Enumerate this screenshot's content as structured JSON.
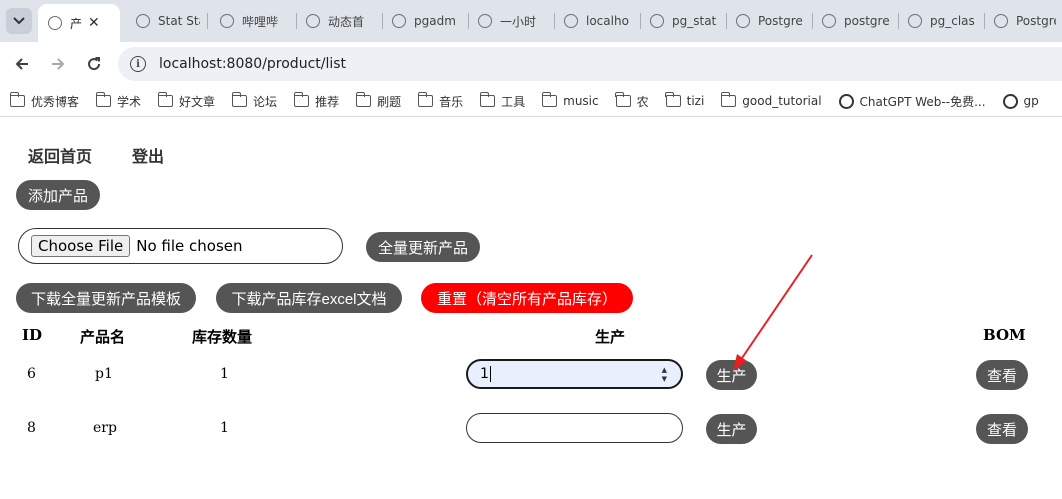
{
  "browser": {
    "tabs": [
      {
        "title": "产",
        "active": true
      },
      {
        "title": "Stat Sta",
        "active": false
      },
      {
        "title": "哔哩哔",
        "active": false
      },
      {
        "title": "动态首",
        "active": false
      },
      {
        "title": "pgadm",
        "active": false
      },
      {
        "title": "一小时",
        "active": false
      },
      {
        "title": "localho",
        "active": false
      },
      {
        "title": "pg_stat",
        "active": false
      },
      {
        "title": "Postgre",
        "active": false
      },
      {
        "title": "postgre",
        "active": false
      },
      {
        "title": "pg_clas",
        "active": false
      },
      {
        "title": "Postgre",
        "active": false
      }
    ],
    "url": "localhost:8080/product/list",
    "bookmarks": [
      {
        "label": "优秀博客",
        "type": "folder"
      },
      {
        "label": "学术",
        "type": "folder"
      },
      {
        "label": "好文章",
        "type": "folder"
      },
      {
        "label": "论坛",
        "type": "folder"
      },
      {
        "label": "推荐",
        "type": "folder"
      },
      {
        "label": "刷题",
        "type": "folder"
      },
      {
        "label": "音乐",
        "type": "folder"
      },
      {
        "label": "工具",
        "type": "folder"
      },
      {
        "label": "music",
        "type": "folder"
      },
      {
        "label": "农",
        "type": "folder"
      },
      {
        "label": "tizi",
        "type": "folder"
      },
      {
        "label": "good_tutorial",
        "type": "folder"
      },
      {
        "label": "ChatGPT Web--免费...",
        "type": "link"
      },
      {
        "label": "gp",
        "type": "link"
      }
    ]
  },
  "nav": {
    "home": "返回首页",
    "logout": "登出"
  },
  "actions": {
    "add_product": "添加产品",
    "file_button": "Choose File",
    "file_status": "No file chosen",
    "full_update": "全量更新产品",
    "download_template": "下载全量更新产品模板",
    "download_stock": "下载产品库存excel文档",
    "reset": "重置（清空所有产品库存）"
  },
  "table": {
    "headers": {
      "id": "ID",
      "name": "产品名",
      "stock": "库存数量",
      "produce": "生产",
      "bom": "BOM"
    },
    "rows": [
      {
        "id": "6",
        "name": "p1",
        "stock": "1",
        "qty": "1",
        "produce_label": "生产",
        "bom_label": "查看"
      },
      {
        "id": "8",
        "name": "erp",
        "stock": "1",
        "qty": "",
        "produce_label": "生产",
        "bom_label": "查看"
      }
    ]
  },
  "colors": {
    "button": "#555555",
    "danger": "#ff0000",
    "annotation_arrow": "#e82020"
  },
  "icons": {
    "tab_search": "chevron-down-icon",
    "back": "arrow-left-icon",
    "forward": "arrow-right-icon",
    "reload": "reload-icon",
    "site_info": "info-icon",
    "bookmark_folder": "folder-icon"
  }
}
